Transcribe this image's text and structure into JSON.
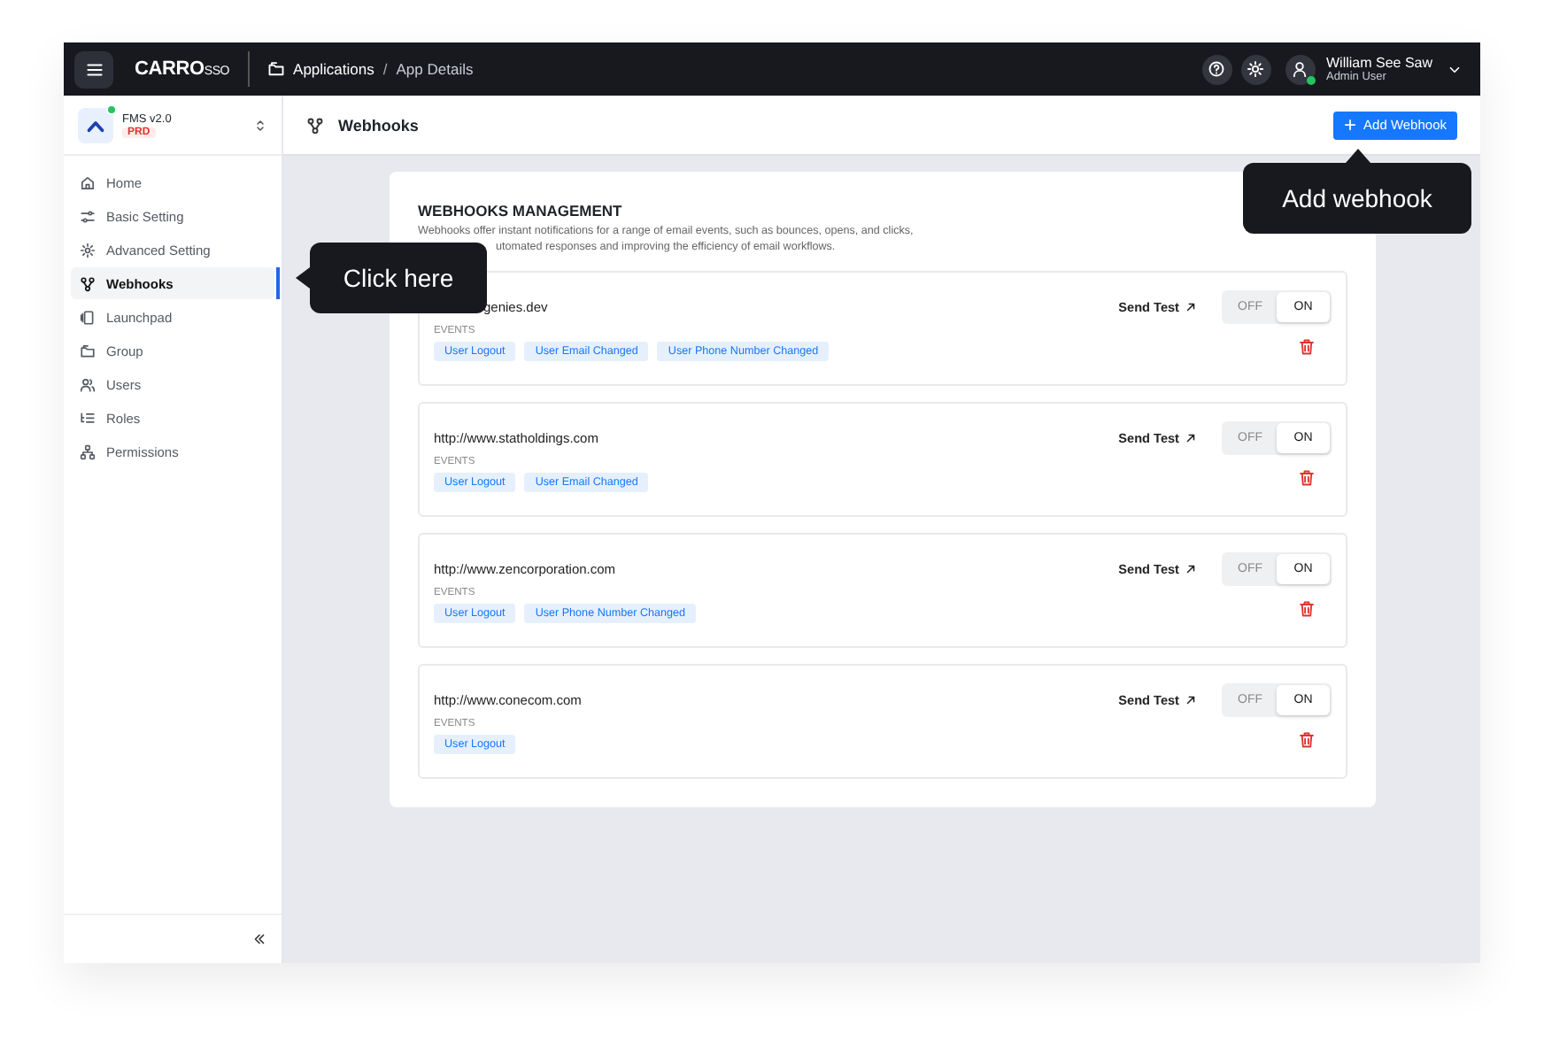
{
  "topbar": {
    "brand": "CARRO",
    "brand_suffix": "SSO",
    "breadcrumb": [
      "Applications",
      "App Details"
    ],
    "breadcrumb_separator": "/",
    "user": {
      "name": "William See Saw",
      "role": "Admin User",
      "online": true
    }
  },
  "app": {
    "name": "FMS v2.0",
    "env": "PRD",
    "online": true
  },
  "sidebar": {
    "items": [
      {
        "label": "Home",
        "selected": false
      },
      {
        "label": "Basic Setting",
        "selected": false
      },
      {
        "label": "Advanced Setting",
        "selected": false
      },
      {
        "label": "Webhooks",
        "selected": true
      },
      {
        "label": "Launchpad",
        "selected": false
      },
      {
        "label": "Group",
        "selected": false
      },
      {
        "label": "Users",
        "selected": false
      },
      {
        "label": "Roles",
        "selected": false
      },
      {
        "label": "Permissions",
        "selected": false
      }
    ]
  },
  "page": {
    "title": "Webhooks",
    "add_button": "Add Webhook"
  },
  "management": {
    "title": "WEBHOOKS MANAGEMENT",
    "description_lines": [
      "Webhooks offer instant notifications for a range of email events, such as bounces, opens, and clicks,",
      "utomated responses and improving the efficiency of email workflows."
    ],
    "webhooks": [
      {
        "url": "genies.dev",
        "send_test": "Send Test",
        "events_label": "EVENTS",
        "events": [
          "User Logout",
          "User Email Changed",
          "User Phone Number Changed"
        ],
        "toggle": {
          "off": "OFF",
          "on": "ON",
          "enabled": true
        }
      },
      {
        "url": "http://www.statholdings.com",
        "send_test": "Send Test",
        "events_label": "EVENTS",
        "events": [
          "User Logout",
          "User Email Changed"
        ],
        "toggle": {
          "off": "OFF",
          "on": "ON",
          "enabled": true
        }
      },
      {
        "url": "http://www.zencorporation.com",
        "send_test": "Send Test",
        "events_label": "EVENTS",
        "events": [
          "User Logout",
          "User Phone Number Changed"
        ],
        "toggle": {
          "off": "OFF",
          "on": "ON",
          "enabled": true
        }
      },
      {
        "url": "http://www.conecom.com",
        "send_test": "Send Test",
        "events_label": "EVENTS",
        "events": [
          "User Logout"
        ],
        "toggle": {
          "off": "OFF",
          "on": "ON",
          "enabled": true
        }
      }
    ]
  },
  "tooltips": [
    {
      "text": "Click here",
      "kind": "left"
    },
    {
      "text": "Add webhook",
      "kind": "up"
    }
  ]
}
